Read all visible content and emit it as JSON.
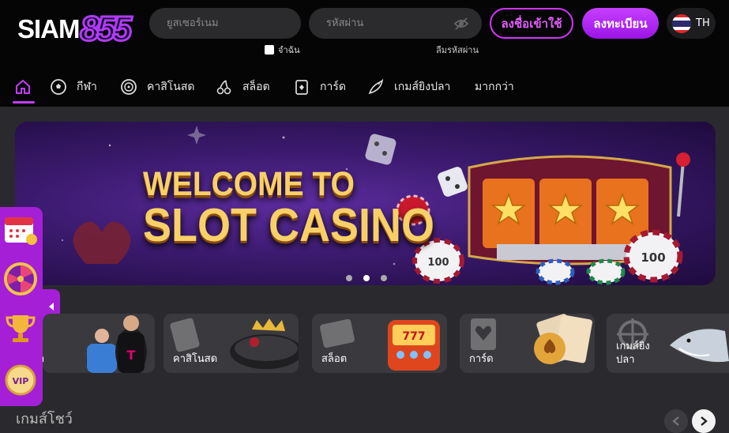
{
  "brand": {
    "name_part1": "SIAM",
    "name_part2": "855"
  },
  "login": {
    "username_placeholder": "ยูสเซอร์เนม",
    "password_placeholder": "รหัสผ่าน",
    "remember_label": "จำฉัน",
    "forgot_label": "ลืมรหัสผ่าน",
    "login_button": "ลงชื่อเข้าใช้",
    "register_button": "ลงทะเบียน",
    "language": "TH"
  },
  "nav": {
    "items": [
      {
        "label": "",
        "icon": "home-icon"
      },
      {
        "label": "กีฬา",
        "icon": "soccer-ball-icon"
      },
      {
        "label": "คาสิโนสด",
        "icon": "roulette-icon"
      },
      {
        "label": "สล็อต",
        "icon": "cherry-icon"
      },
      {
        "label": "การ์ด",
        "icon": "card-icon"
      },
      {
        "label": "เกมส์ยิงปลา",
        "icon": "fish-icon"
      },
      {
        "label": "มากกว่า",
        "icon": ""
      }
    ]
  },
  "banner": {
    "line1": "WELCOME TO",
    "line2": "SLOT CASINO",
    "chip_value": "100",
    "slides": 3,
    "active_slide": 2
  },
  "categories": [
    {
      "label": "า",
      "icon": "soccer-icon"
    },
    {
      "label": "คาสิโนสด",
      "icon": "casino-icon"
    },
    {
      "label": "สล็อต",
      "icon": "slot-icon"
    },
    {
      "label": "การ์ด",
      "icon": "card-icon"
    },
    {
      "label_line1": "เกมส์ยิง",
      "label_line2": "ปลา",
      "icon": "fish-icon"
    }
  ],
  "section": {
    "title": "เกมส์โชว์"
  },
  "colors": {
    "accent": "#c43cff",
    "background": "#2a2a2e",
    "header": "#050505"
  }
}
